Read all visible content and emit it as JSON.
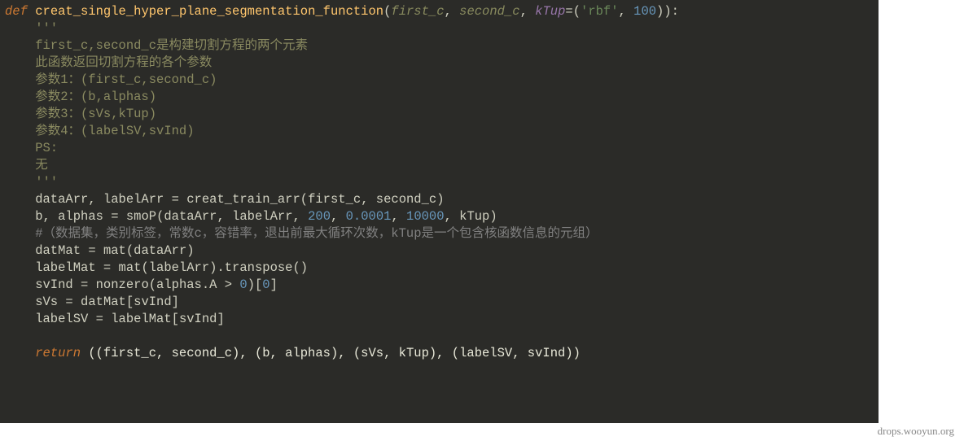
{
  "code": {
    "keyword_def": "def",
    "func_name": "creat_single_hyper_plane_segmentation_function",
    "open_paren": "(",
    "param1": "first_c",
    "comma1": ", ",
    "param2": "second_c",
    "comma2": ", ",
    "param3_name": "kTup",
    "eq": "=",
    "tup_open": "(",
    "rbf_str": "'rbf'",
    "tup_comma": ", ",
    "tup_num": "100",
    "tup_close": ")",
    "close_paren": "):",
    "tri_open": "    '''",
    "doc_l1": "    first_c,second_c是构建切割方程的两个元素",
    "doc_l2": "    此函数返回切割方程的各个参数",
    "doc_l3": "    参数1：(first_c,second_c)",
    "doc_l4": "    参数2：(b,alphas)",
    "doc_l5": "    参数3：(sVs,kTup)",
    "doc_l6": "    参数4：(labelSV,svInd)",
    "doc_l7": "    PS:",
    "doc_l8": "    无",
    "tri_close": "    '''",
    "line_data_head": "    dataArr, labelArr ",
    "assign1": "=",
    "call_train": " creat_train_arr(first_c, second_c)",
    "line_smo_head": "    b, alphas ",
    "assign2": "=",
    "smo_name": " smoP",
    "smo_args_open": "(dataArr, labelArr, ",
    "smo_n1": "200",
    "smo_c1": ", ",
    "smo_n2": "0.0001",
    "smo_c2": ", ",
    "smo_n3": "10000",
    "smo_c3": ", kTup)",
    "comment_line": "    #（数据集，类别标签，常数c，容错率，退出前最大循环次数，kTup是一个包含核函数信息的元组）",
    "datMat_line_a": "    datMat ",
    "datMat_line_b": " mat(dataArr)",
    "labelMat_line_a": "    labelMat ",
    "labelMat_line_b": " mat(labelArr).transpose()",
    "svInd_line_a": "    svInd ",
    "svInd_line_b": " nonzero(alphas.A ",
    "gt": ">",
    "zero": " 0",
    "svInd_line_c": ")[",
    "zero2": "0",
    "svInd_line_d": "]",
    "sVs_line_a": "    sVs ",
    "sVs_line_b": " datMat[svInd]",
    "labelSV_line_a": "    labelSV ",
    "labelSV_line_b": " labelMat[svInd]",
    "return_kw": "    return",
    "return_expr": " ((first_c, second_c), (b, alphas), (sVs, kTup), (labelSV, svInd))"
  },
  "watermark": "drops.wooyun.org"
}
